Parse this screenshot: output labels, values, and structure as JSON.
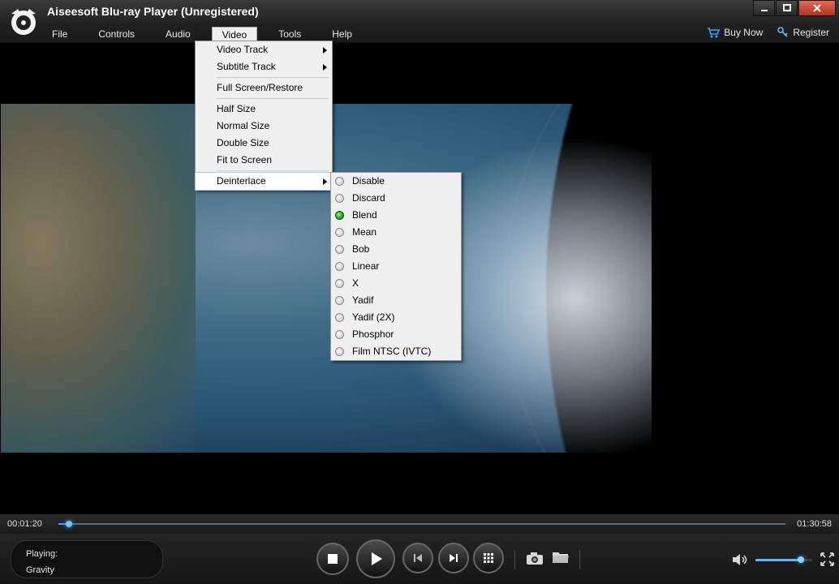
{
  "app": {
    "title": "Aiseesoft Blu-ray Player (Unregistered)"
  },
  "menubar": [
    "File",
    "Controls",
    "Audio",
    "Video",
    "Tools",
    "Help"
  ],
  "header_links": {
    "buy_now": "Buy Now",
    "register": "Register"
  },
  "video_menu": {
    "items": [
      {
        "label": "Video Track",
        "submenu": true
      },
      {
        "label": "Subtitle Track",
        "submenu": true
      },
      {
        "label": "Full Screen/Restore"
      },
      {
        "label": "Half Size"
      },
      {
        "label": "Normal Size"
      },
      {
        "label": "Double Size"
      },
      {
        "label": "Fit to Screen"
      },
      {
        "label": "Deinterlace",
        "submenu": true
      }
    ]
  },
  "deinterlace_menu": {
    "selected": "Blend",
    "items": [
      "Disable",
      "Discard",
      "Blend",
      "Mean",
      "Bob",
      "Linear",
      "X",
      "Yadif",
      "Yadif (2X)",
      "Phosphor",
      "Film NTSC (IVTC)"
    ]
  },
  "playback": {
    "current_time": "00:01:20",
    "total_time": "01:30:58",
    "progress": 0.015
  },
  "now_playing": {
    "label": "Playing:",
    "title": "Gravity"
  },
  "volume": {
    "level": 0.8
  },
  "colors": {
    "accent": "#3aa0ff",
    "radio_on": "#1ea01e"
  }
}
